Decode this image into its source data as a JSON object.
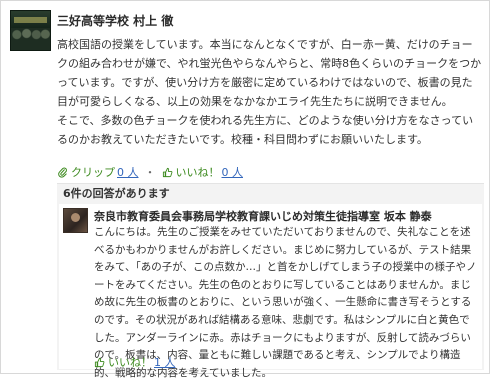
{
  "post": {
    "author": "三好高等学校 村上 徹",
    "body": [
      "高校国語の授業をしています。本当になんとなくですが、白ー赤ー黄、だけのチョークの組み合わせが嫌で、やれ蛍光色やらなんやらと、常時8色くらいのチョークをつかっています。ですが、使い分け方を厳密に定めているわけではないので、板書の見た目が可愛らしくなる、以上の効果をなかなかエライ先生たちに説明できません。",
      "そこで、多数の色チョークを使われる先生方に、どのような使い分け方をなさっているのかお教えていただきたいです。校種・科目問わずにお願いいたします。"
    ],
    "actions": {
      "clip_label": "クリップ",
      "clip_count": "0 人",
      "separator": "・",
      "like_label": "いいね！",
      "like_count": "0 人"
    }
  },
  "answers": {
    "header": "6件の回答があります",
    "items": [
      {
        "author": "奈良市教育委員会事務局学校教育課いじめ対策生徒指導室 坂本 静泰",
        "body": "こんにちは。先生のご授業をみせていただいておりませんので、失礼なことを述べるかもわかりませんがお許しください。まじめに努力しているが、テスト結果をみて、「あの子が、この点数か…」と首をかしげてしまう子の授業中の様子やノートをみてください。先生の色のとおりに写していることはありませんか。まじめ故に先生の板書のとおりに、という思いが強く、一生懸命に書き写そうとするのです。その状況があれば結構ある意味、悲劇です。私はシンプルに白と黄色でした。アンダーラインに赤。赤はチョークにもよりますが、反射して読みづらいので。板書は、内容、量ともに難しい課題であると考え、シンプルでより構造的、戦略的な内容を考えていました。",
        "like_label": "いいね！",
        "like_count": "1 人"
      }
    ]
  },
  "colors": {
    "action_label": "#3d8a1f",
    "link": "#3366bb",
    "answer_panel_bg": "#f3f3f3"
  },
  "icons": {
    "clip": "paperclip-icon",
    "like": "thumbs-up-icon"
  }
}
